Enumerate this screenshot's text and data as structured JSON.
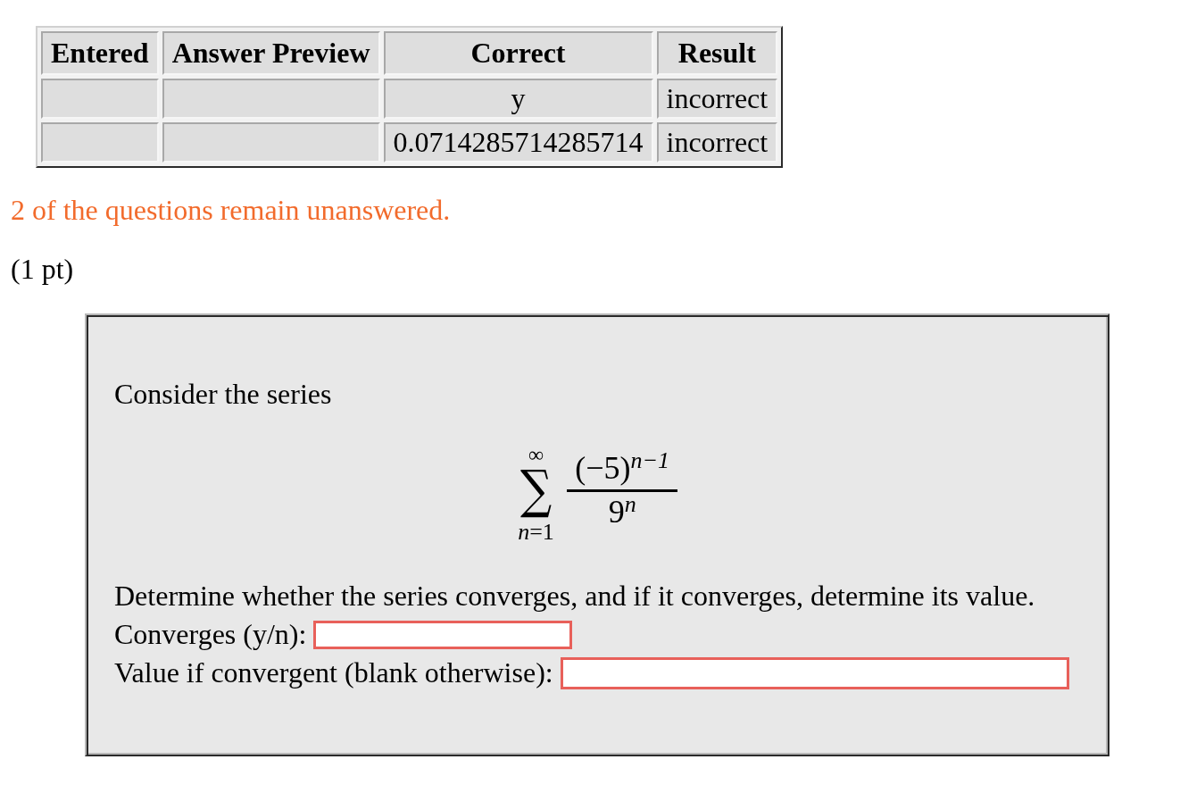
{
  "results_table": {
    "columns": [
      "Entered",
      "Answer Preview",
      "Correct",
      "Result"
    ],
    "rows": [
      {
        "correct": "y",
        "result": "incorrect"
      },
      {
        "correct": "0.0714285714285714",
        "result": "incorrect"
      }
    ]
  },
  "message": "2 of the questions remain unanswered.",
  "points": "(1 pt)",
  "problem": {
    "intro": "Consider the series",
    "series": {
      "upper": "∞",
      "operator": "∑",
      "lower": "*n*=1",
      "numerator": "(−5)$^{n−1}$",
      "denominator": "9$^{n}$"
    },
    "question": "Determine whether the series converges, and if it converges, determine its value.",
    "fields": [
      {
        "label": "Converges (y/n):",
        "flagged": true
      },
      {
        "label": "Value if convergent (blank otherwise):",
        "flagged": true
      }
    ]
  }
}
